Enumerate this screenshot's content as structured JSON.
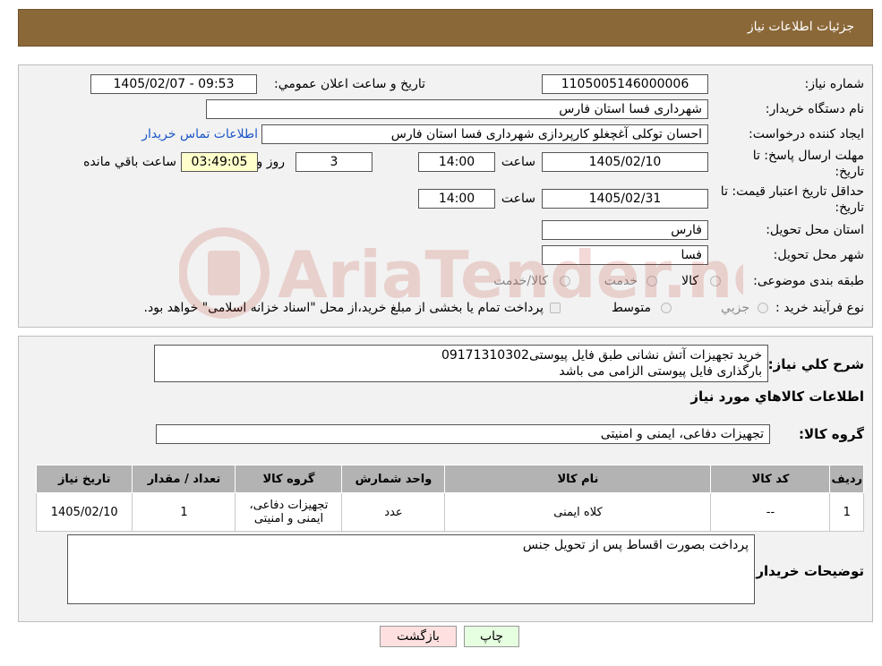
{
  "header": {
    "title": "جزئیات اطلاعات نیاز"
  },
  "form": {
    "need_number_label": "شماره نیاز:",
    "need_number": "1105005146000006",
    "announce_label": "تاریخ و ساعت اعلان عمومي:",
    "announce_value": "1405/02/07 - 09:53",
    "buyer_org_label": "نام دستگاه خریدار:",
    "buyer_org": "شهرداری فسا استان فارس",
    "creator_label": "ایجاد کننده درخواست:",
    "creator": "احسان توکلی آغچغلو کارپردازی شهرداری فسا استان فارس",
    "contact_link": "اطلاعات تماس خریدار",
    "deadline_label_1": "مهلت ارسال پاسخ: تا",
    "deadline_label_2": "تاریخ:",
    "deadline_date": "1405/02/10",
    "time_label": "ساعت",
    "deadline_time": "14:00",
    "days_value": "3",
    "days_label": "روز و",
    "remaining_time": "03:49:05",
    "remaining_label": "ساعت باقي مانده",
    "price_valid_label_1": "حداقل تاریخ اعتبار قیمت: تا",
    "price_valid_label_2": "تاریخ:",
    "price_valid_date": "1405/02/31",
    "price_valid_time": "14:00",
    "province_label": "استان محل تحویل:",
    "province": "فارس",
    "city_label": "شهر محل تحویل:",
    "city": "فسا",
    "category_label": "طبقه بندی موضوعی:",
    "category_options": [
      "کالا",
      "خدمت",
      "کالا/خدمت"
    ],
    "process_label": "نوع فرآیند خرید :",
    "process_options": [
      "جزيي",
      "متوسط"
    ],
    "process_note": "پرداخت تمام یا بخشی از مبلغ خرید،از محل \"اسناد خزانه اسلامی\" خواهد بود."
  },
  "details": {
    "summary_label": "شرح کلي نياز:",
    "summary_line1": "خرید تجهیزات آتش نشانی طبق فایل پیوستی09171310302",
    "summary_line2": "بارگذاری فایل پیوستی الزامی می باشد",
    "goods_info_title": "اطلاعات کالاهاي مورد نياز",
    "goods_group_label": "گروه کالا:",
    "goods_group": "تجهیزات دفاعی، ایمنی و امنیتی"
  },
  "table": {
    "headers": [
      "رديف",
      "کد کالا",
      "نام کالا",
      "واحد شمارش",
      "گروه کالا",
      "تعداد / مقدار",
      "تاریخ نیاز"
    ],
    "rows": [
      [
        "1",
        "--",
        "کلاه ایمنی",
        "عدد",
        "تجهیزات دفاعی، ایمنی و امنیتی",
        "1",
        "1405/02/10"
      ]
    ]
  },
  "buyer_notes": {
    "label": "توضیحات خریدار:",
    "text": "پرداخت بصورت اقساط پس از تحویل جنس"
  },
  "buttons": {
    "print": "چاپ",
    "back": "بازگشت"
  },
  "watermark": {
    "text": "AriaTender.neT"
  },
  "colors": {
    "header_bg": "#8b6838",
    "link": "#1a56c8",
    "back_btn_bg": "#ffe0e0",
    "print_btn_bg": "#e6ffe0"
  }
}
